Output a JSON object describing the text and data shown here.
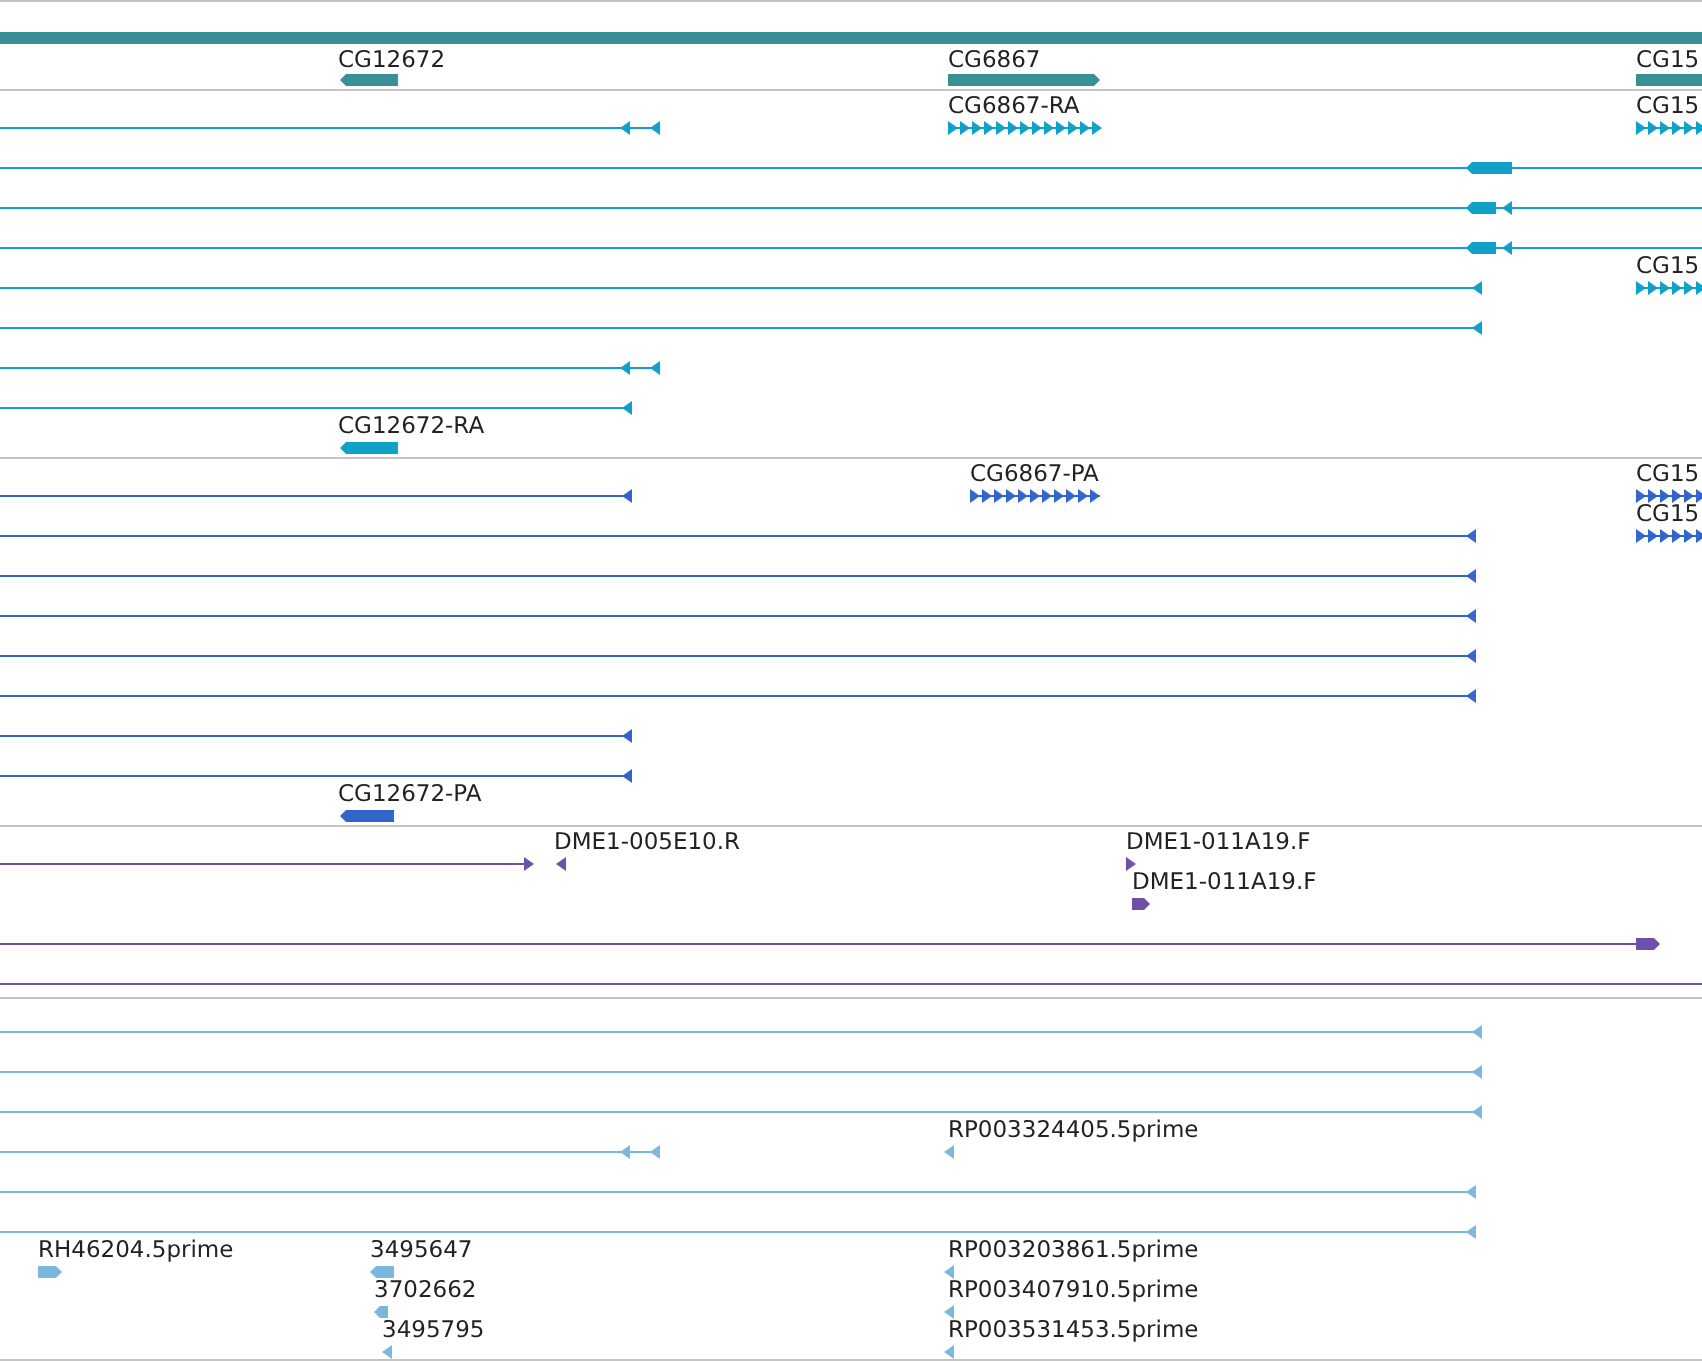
{
  "tracks": [
    {
      "kind": "gene",
      "color": "#3a8f96",
      "labels": [
        "CG12672",
        "CG6867",
        "CG15"
      ]
    },
    {
      "kind": "transcript",
      "color": "#10a0c8",
      "labels": [
        "CG6867-RA",
        "CG15",
        "CG15",
        "CG12672-RA"
      ]
    },
    {
      "kind": "transcript",
      "color": "#3366cc",
      "labels": [
        "CG6867-PA",
        "CG15",
        "CG15",
        "CG12672-PA"
      ]
    },
    {
      "kind": "alignment",
      "color": "#6f4fa8",
      "labels": [
        "DME1-005E10.R",
        "DME1-011A19.F",
        "DME1-011A19.F"
      ]
    },
    {
      "kind": "alignment",
      "color": "#7ab8dd",
      "labels": [
        "RP003324405.5prime",
        "RH46204.5prime",
        "3495647",
        "RP003203861.5prime",
        "3702662",
        "RP003407910.5prime",
        "3495795",
        "RP003531453.5prime"
      ]
    }
  ]
}
